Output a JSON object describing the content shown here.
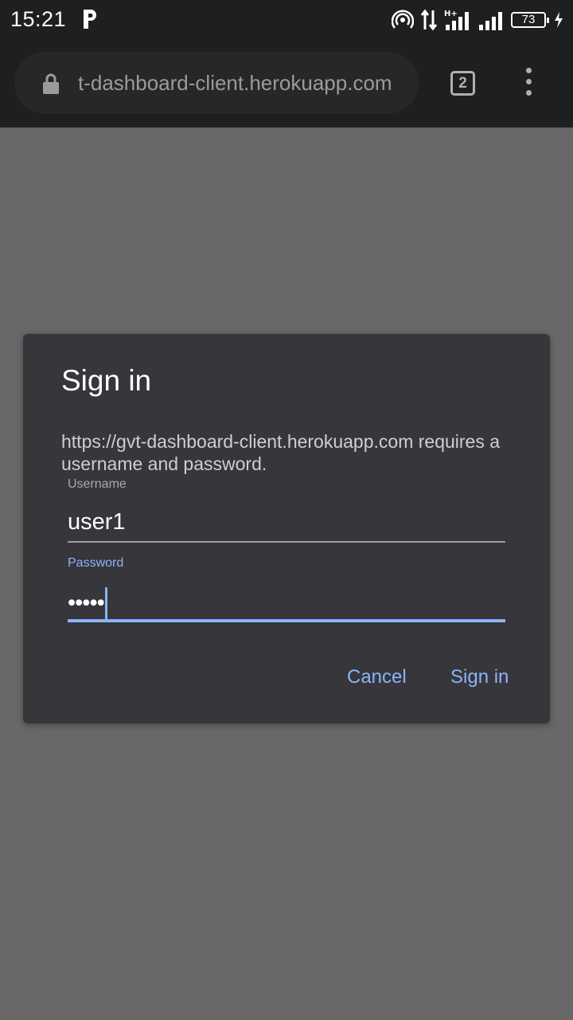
{
  "status_bar": {
    "time": "15:21",
    "battery_level": "73",
    "icons": [
      "parking-icon",
      "hotspot-icon",
      "data-transfer-icon",
      "signal-hplus-icon",
      "signal-icon",
      "battery-icon",
      "charging-icon"
    ]
  },
  "browser": {
    "url": "t-dashboard-client.herokuapp.com",
    "tab_count": "2"
  },
  "dialog": {
    "title": "Sign in",
    "message": "https://gvt-dashboard-client.herokuapp.com requires a username and password.",
    "username_label": "Username",
    "username_value": "user1",
    "password_label": "Password",
    "password_value": "•••••",
    "cancel_label": "Cancel",
    "signin_label": "Sign in"
  },
  "colors": {
    "accent": "#8ab4f8",
    "dialog_bg": "#37363b",
    "scrim": "#686868",
    "toolbar_bg": "#1e1f21"
  }
}
